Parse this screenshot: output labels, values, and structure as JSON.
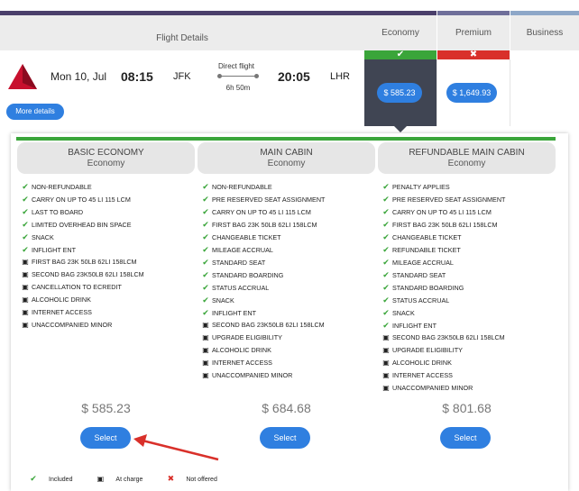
{
  "header": {
    "flight_details": "Flight Details",
    "economy": "Economy",
    "premium": "Premium",
    "business": "Business",
    "economy_status_icon": "check-icon",
    "premium_status_icon": "x-icon"
  },
  "flight": {
    "date": "Mon 10, Jul",
    "dep_time": "08:15",
    "dep_airport": "JFK",
    "stops": "Direct flight",
    "duration": "6h 50m",
    "arr_time": "20:05",
    "arr_airport": "LHR",
    "more_details": "More details",
    "economy_price": "$ 585.23",
    "premium_price": "$ 1,649.93"
  },
  "fares": [
    {
      "name": "BASIC ECONOMY",
      "cabin": "Economy",
      "price": "$ 585.23",
      "select": "Select",
      "features": [
        {
          "status": "included",
          "text": "NON-REFUNDABLE"
        },
        {
          "status": "included",
          "text": "CARRY ON UP TO 45 LI 115 LCM"
        },
        {
          "status": "included",
          "text": "LAST TO BOARD"
        },
        {
          "status": "included",
          "text": "LIMITED OVERHEAD BIN SPACE"
        },
        {
          "status": "included",
          "text": "SNACK"
        },
        {
          "status": "included",
          "text": "INFLIGHT ENT"
        },
        {
          "status": "charge",
          "text": "FIRST BAG 23K 50LB 62LI 158LCM"
        },
        {
          "status": "charge",
          "text": "SECOND BAG 23K50LB 62LI 158LCM"
        },
        {
          "status": "charge",
          "text": "CANCELLATION TO ECREDIT"
        },
        {
          "status": "charge",
          "text": "ALCOHOLIC DRINK"
        },
        {
          "status": "charge",
          "text": "INTERNET ACCESS"
        },
        {
          "status": "charge",
          "text": "UNACCOMPANIED MINOR"
        }
      ]
    },
    {
      "name": "MAIN CABIN",
      "cabin": "Economy",
      "price": "$ 684.68",
      "select": "Select",
      "features": [
        {
          "status": "included",
          "text": "NON-REFUNDABLE"
        },
        {
          "status": "included",
          "text": "PRE RESERVED SEAT ASSIGNMENT"
        },
        {
          "status": "included",
          "text": "CARRY ON UP TO 45 LI 115 LCM"
        },
        {
          "status": "included",
          "text": "FIRST BAG 23K 50LB 62LI 158LCM"
        },
        {
          "status": "included",
          "text": "CHANGEABLE TICKET"
        },
        {
          "status": "included",
          "text": "MILEAGE ACCRUAL"
        },
        {
          "status": "included",
          "text": "STANDARD SEAT"
        },
        {
          "status": "included",
          "text": "STANDARD BOARDING"
        },
        {
          "status": "included",
          "text": "STATUS ACCRUAL"
        },
        {
          "status": "included",
          "text": "SNACK"
        },
        {
          "status": "included",
          "text": "INFLIGHT ENT"
        },
        {
          "status": "charge",
          "text": "SECOND BAG 23K50LB 62LI 158LCM"
        },
        {
          "status": "charge",
          "text": "UPGRADE ELIGIBILITY"
        },
        {
          "status": "charge",
          "text": "ALCOHOLIC DRINK"
        },
        {
          "status": "charge",
          "text": "INTERNET ACCESS"
        },
        {
          "status": "charge",
          "text": "UNACCOMPANIED MINOR"
        }
      ]
    },
    {
      "name": "REFUNDABLE MAIN CABIN",
      "cabin": "Economy",
      "price": "$ 801.68",
      "select": "Select",
      "features": [
        {
          "status": "included",
          "text": "PENALTY APPLIES"
        },
        {
          "status": "included",
          "text": "PRE RESERVED SEAT ASSIGNMENT"
        },
        {
          "status": "included",
          "text": "CARRY ON UP TO 45 LI 115 LCM"
        },
        {
          "status": "included",
          "text": "FIRST BAG 23K 50LB 62LI 158LCM"
        },
        {
          "status": "included",
          "text": "CHANGEABLE TICKET"
        },
        {
          "status": "included",
          "text": "REFUNDABLE TICKET"
        },
        {
          "status": "included",
          "text": "MILEAGE ACCRUAL"
        },
        {
          "status": "included",
          "text": "STANDARD SEAT"
        },
        {
          "status": "included",
          "text": "STANDARD BOARDING"
        },
        {
          "status": "included",
          "text": "STATUS ACCRUAL"
        },
        {
          "status": "included",
          "text": "SNACK"
        },
        {
          "status": "included",
          "text": "INFLIGHT ENT"
        },
        {
          "status": "charge",
          "text": "SECOND BAG 23K50LB 62LI 158LCM"
        },
        {
          "status": "charge",
          "text": "UPGRADE ELIGIBILITY"
        },
        {
          "status": "charge",
          "text": "ALCOHOLIC DRINK"
        },
        {
          "status": "charge",
          "text": "INTERNET ACCESS"
        },
        {
          "status": "charge",
          "text": "UNACCOMPANIED MINOR"
        }
      ]
    }
  ],
  "legend": {
    "included": "Included",
    "charge": "At charge",
    "not_offered": "Not offered"
  },
  "colors": {
    "accent_blue": "#2f7fe0",
    "included_green": "#3aa53a",
    "not_offered_red": "#d9302a",
    "header_purple": "#4a3f6b",
    "annotation_arrow": "#d9302a"
  }
}
